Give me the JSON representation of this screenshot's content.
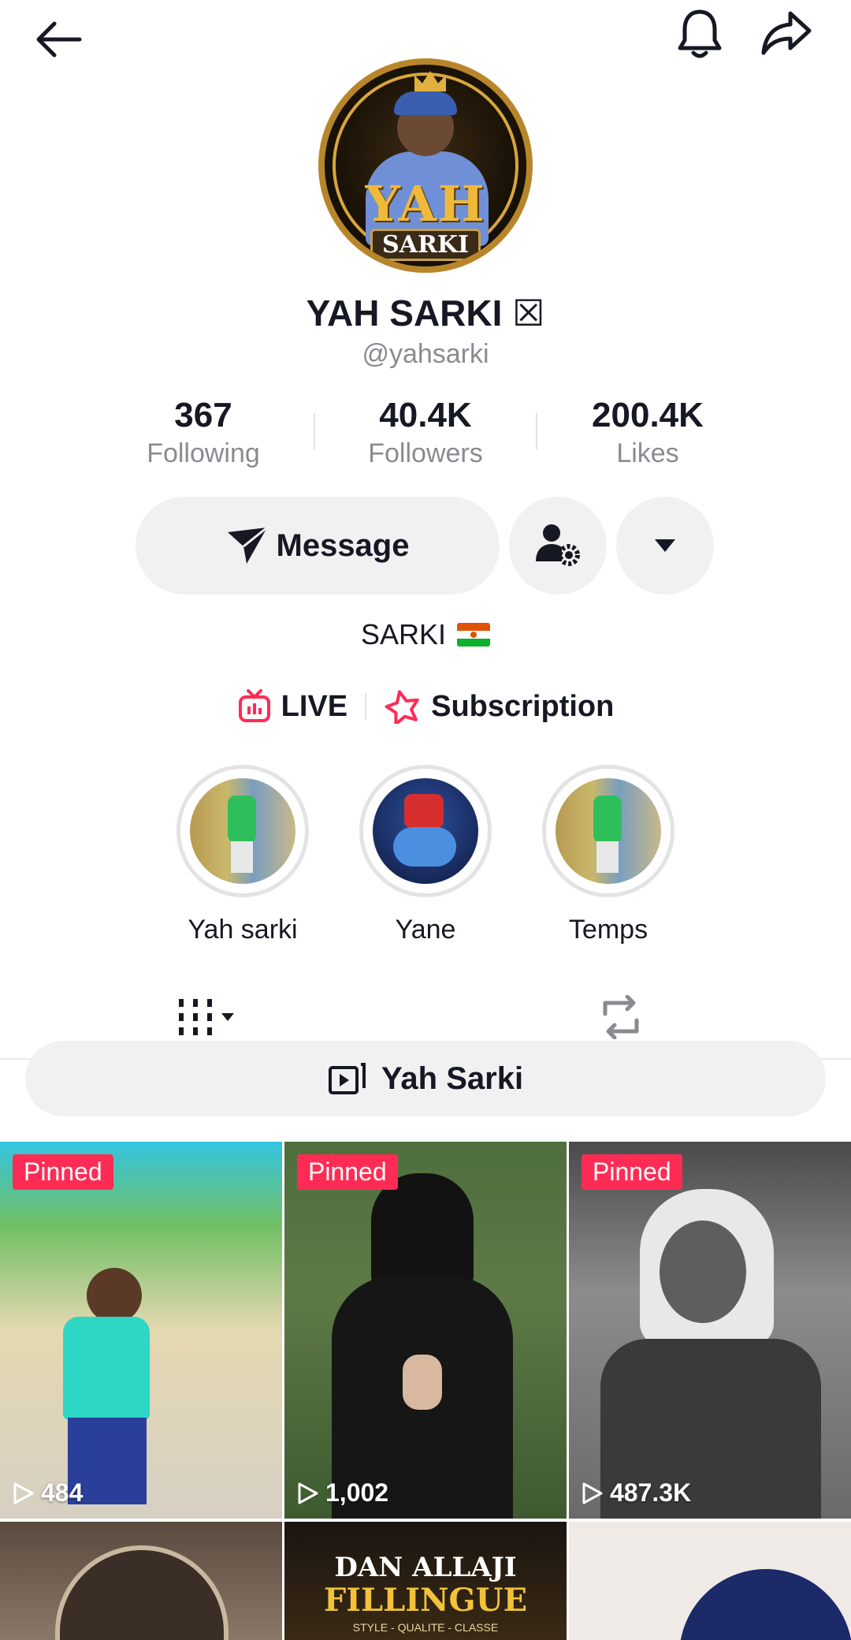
{
  "profile": {
    "display_name": "YAH SARKI ☒",
    "handle": "@yahsarki",
    "avatar_text_main": "YAH",
    "avatar_text_sub": "SARKI"
  },
  "stats": [
    {
      "value": "367",
      "label": "Following"
    },
    {
      "value": "40.4K",
      "label": "Followers"
    },
    {
      "value": "200.4K",
      "label": "Likes"
    }
  ],
  "actions": {
    "message_label": "Message"
  },
  "bio": {
    "text": "SARKI"
  },
  "links": {
    "live_label": "LIVE",
    "subscription_label": "Subscription"
  },
  "highlights": [
    {
      "label": "Yah sarki"
    },
    {
      "label": "Yane"
    },
    {
      "label": "Temps"
    }
  ],
  "playlist": {
    "label": "Yah Sarki"
  },
  "videos": [
    {
      "pinned_label": "Pinned",
      "views": "484"
    },
    {
      "pinned_label": "Pinned",
      "views": "1,002"
    },
    {
      "pinned_label": "Pinned",
      "views": "487.3K"
    },
    {
      "pinned_label": "",
      "views": ""
    },
    {
      "pinned_label": "",
      "views": "",
      "thumb_text_1": "DAN ALLAJI",
      "thumb_text_2": "FILLINGUE",
      "thumb_text_3": "STYLE - QUALITE - CLASSE"
    },
    {
      "pinned_label": "",
      "views": ""
    }
  ],
  "colors": {
    "accent": "#fe2c55",
    "text": "#161823",
    "muted": "#8a8b91",
    "button_bg": "#f1f1f2"
  }
}
